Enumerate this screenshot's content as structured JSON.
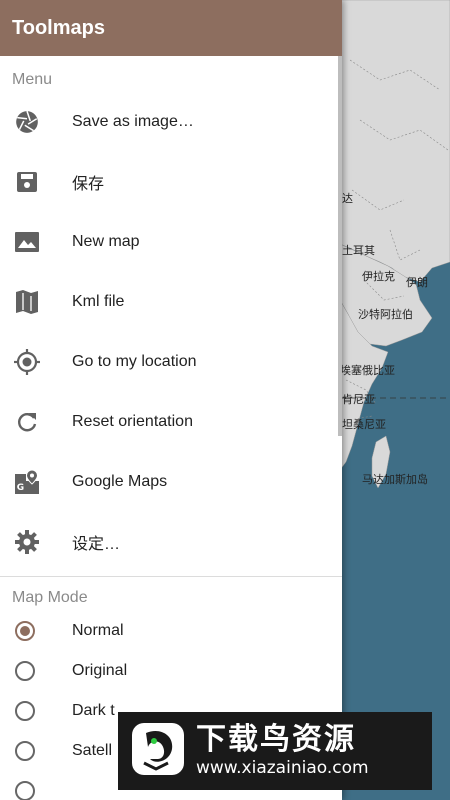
{
  "app": {
    "title": "Toolmaps"
  },
  "menu": {
    "header": "Menu",
    "items": [
      {
        "label": "Save as image…",
        "icon": "camera-shutter-icon"
      },
      {
        "label": "保存",
        "icon": "save-icon"
      },
      {
        "label": "New map",
        "icon": "image-icon"
      },
      {
        "label": "Kml file",
        "icon": "map-icon"
      },
      {
        "label": "Go to my location",
        "icon": "my-location-icon"
      },
      {
        "label": "Reset orientation",
        "icon": "refresh-icon"
      },
      {
        "label": "Google Maps",
        "icon": "google-maps-icon"
      },
      {
        "label": "设定…",
        "icon": "gear-icon"
      }
    ]
  },
  "map_mode": {
    "header": "Map Mode",
    "options": [
      {
        "label": "Normal",
        "checked": true
      },
      {
        "label": "Original",
        "checked": false
      },
      {
        "label": "Dark t",
        "checked": false
      },
      {
        "label": "Satell",
        "checked": false
      },
      {
        "label": "",
        "checked": false
      }
    ]
  },
  "map_labels": [
    "土耳其",
    "伊拉克",
    "伊朗",
    "沙特阿拉伯",
    "埃塞俄比亚",
    "肯尼亚",
    "坦桑尼亚",
    "马达加斯加岛",
    "达"
  ],
  "watermark": {
    "title": "下载鸟资源",
    "url": "www.xiazainiao.com"
  },
  "colors": {
    "header": "#8d6e5f",
    "ocean": "#3f6e86",
    "land": "#d9d9d9",
    "radio_checked": "#8d6e5f"
  }
}
